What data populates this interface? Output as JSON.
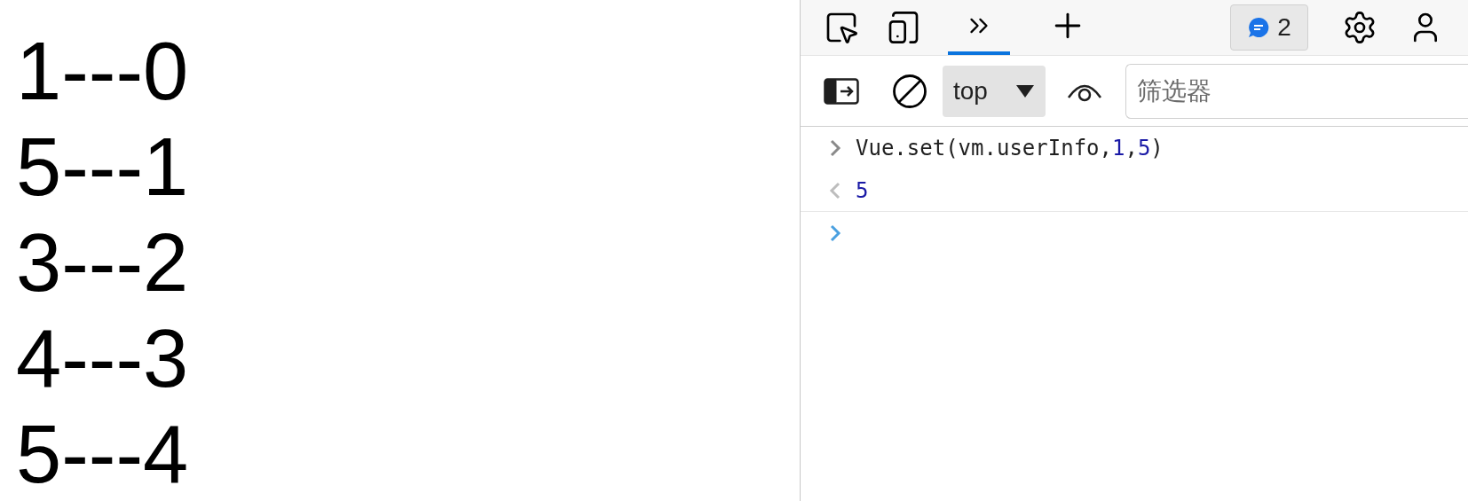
{
  "page": {
    "lines": [
      "1---0",
      "5---1",
      "3---2",
      "4---3",
      "5---4"
    ]
  },
  "devtools": {
    "tabs": [
      {
        "kind": "more",
        "selected": true
      },
      {
        "kind": "add",
        "selected": false
      }
    ],
    "issues_count": "2",
    "context": "top",
    "filter": {
      "placeholder": "筛选器"
    },
    "console": [
      {
        "kind": "input",
        "parts": [
          {
            "kind": "plain",
            "text": "Vue.set(vm.userInfo,"
          },
          {
            "kind": "number",
            "text": "1"
          },
          {
            "kind": "plain",
            "text": ","
          },
          {
            "kind": "number",
            "text": "5"
          },
          {
            "kind": "plain",
            "text": ")"
          }
        ]
      },
      {
        "kind": "output",
        "parts": [
          {
            "kind": "result",
            "text": "5"
          }
        ]
      }
    ]
  }
}
